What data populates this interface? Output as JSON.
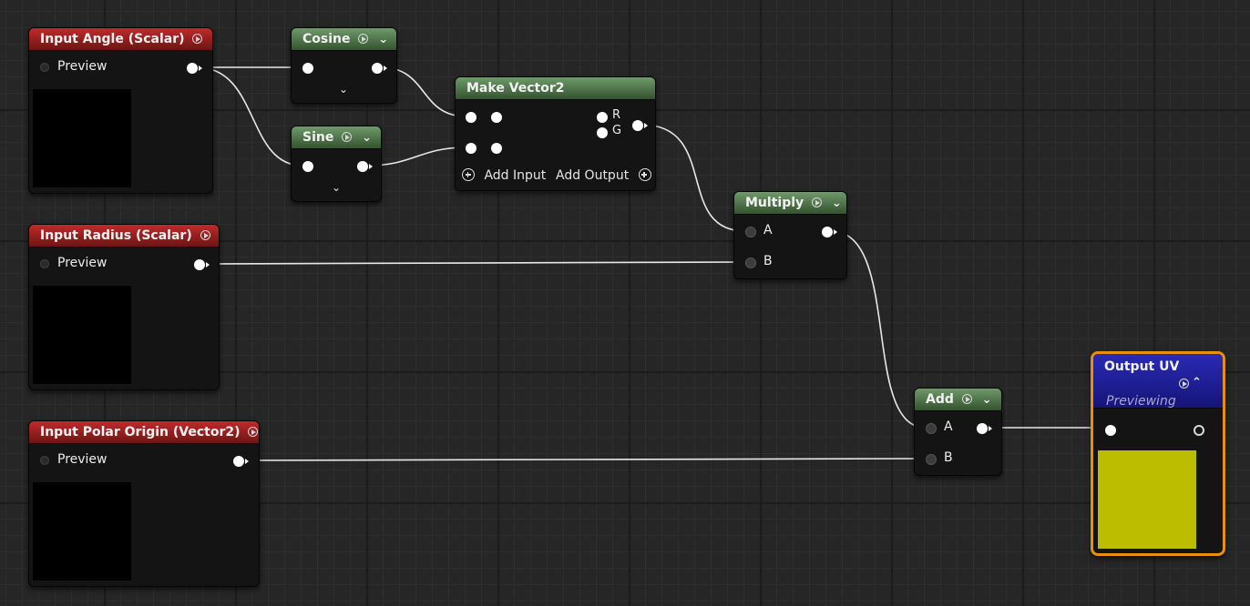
{
  "nodes": {
    "input_angle": {
      "title": "Input Angle (Scalar)",
      "preview_label": "Preview",
      "header_color": "#a32222"
    },
    "input_radius": {
      "title": "Input Radius (Scalar)",
      "preview_label": "Preview",
      "header_color": "#a32222"
    },
    "input_origin": {
      "title": "Input Polar Origin (Vector2)",
      "preview_label": "Preview",
      "header_color": "#a32222"
    },
    "cosine": {
      "title": "Cosine"
    },
    "sine": {
      "title": "Sine"
    },
    "make_vector2": {
      "title": "Make Vector2",
      "pin_r": "R",
      "pin_g": "G",
      "add_input": "Add Input",
      "add_output": "Add Output"
    },
    "multiply": {
      "title": "Multiply",
      "pin_a": "A",
      "pin_b": "B"
    },
    "add": {
      "title": "Add",
      "pin_a": "A",
      "pin_b": "B"
    },
    "output_uv": {
      "title": "Output UV",
      "status": "Previewing",
      "preview_color": "#bdbd00",
      "border_color": "#e8900c",
      "header_color": "#1f1fa0"
    }
  },
  "icons": {
    "preview_toggle": "play-circle-icon",
    "collapse": "chevron-up-icon",
    "expand": "chevron-down-icon",
    "add": "plus-circle-icon"
  }
}
